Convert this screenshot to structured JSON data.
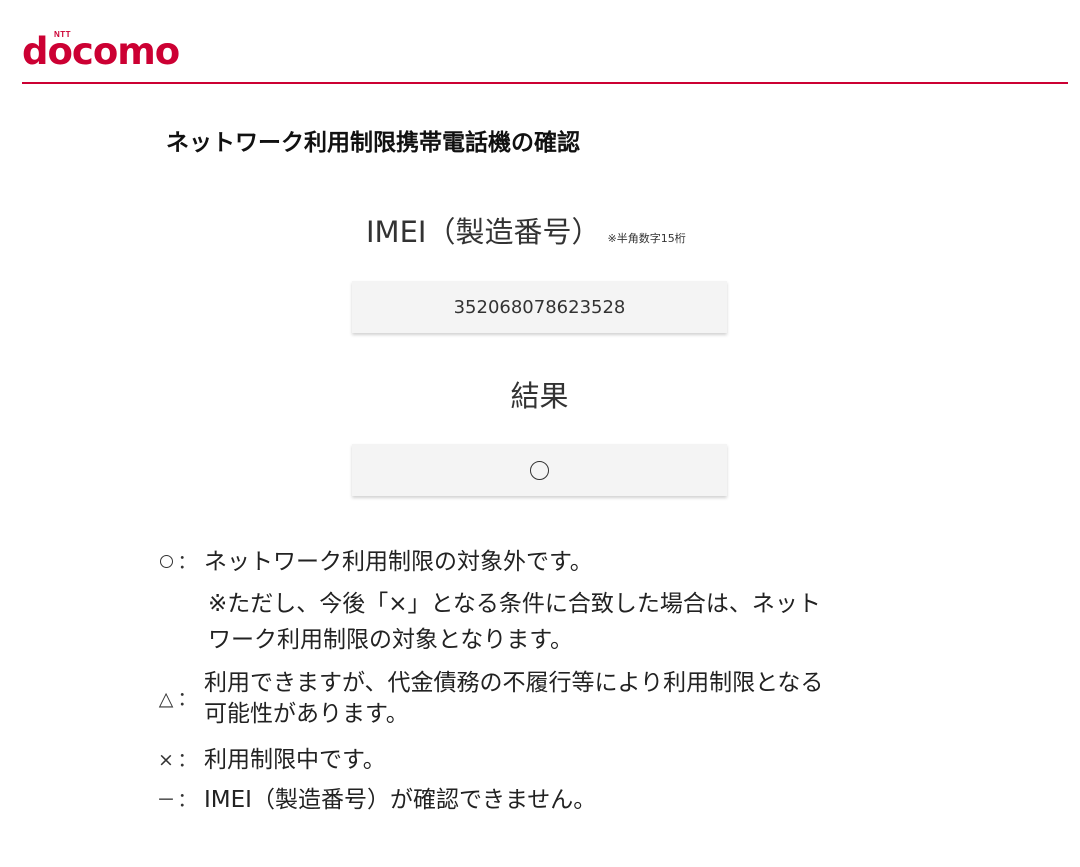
{
  "brand": {
    "ntt": "NTT",
    "name": "docomo",
    "color": "#cc0033"
  },
  "page": {
    "title": "ネットワーク利用制限携帯電話機の確認"
  },
  "imei": {
    "label": "IMEI（製造番号）",
    "note": "※半角数字15桁",
    "value": "352068078623528"
  },
  "result": {
    "label": "結果",
    "symbol": "circle"
  },
  "legend": {
    "circle": {
      "colon": "：",
      "text": "ネットワーク利用制限の対象外です。",
      "note_line1": "※ただし、今後「×」となる条件に合致した場合は、ネット",
      "note_line2": "ワーク利用制限の対象となります。"
    },
    "triangle": {
      "symbol": "△",
      "colon": "：",
      "line1": "利用できますが、代金債務の不履行等により利用制限となる",
      "line2": "可能性があります。"
    },
    "cross": {
      "symbol": "×",
      "colon": "：",
      "text": "利用制限中です。"
    },
    "dash": {
      "symbol": "－",
      "colon": "：",
      "text": "IMEI（製造番号）が確認できません。"
    }
  }
}
